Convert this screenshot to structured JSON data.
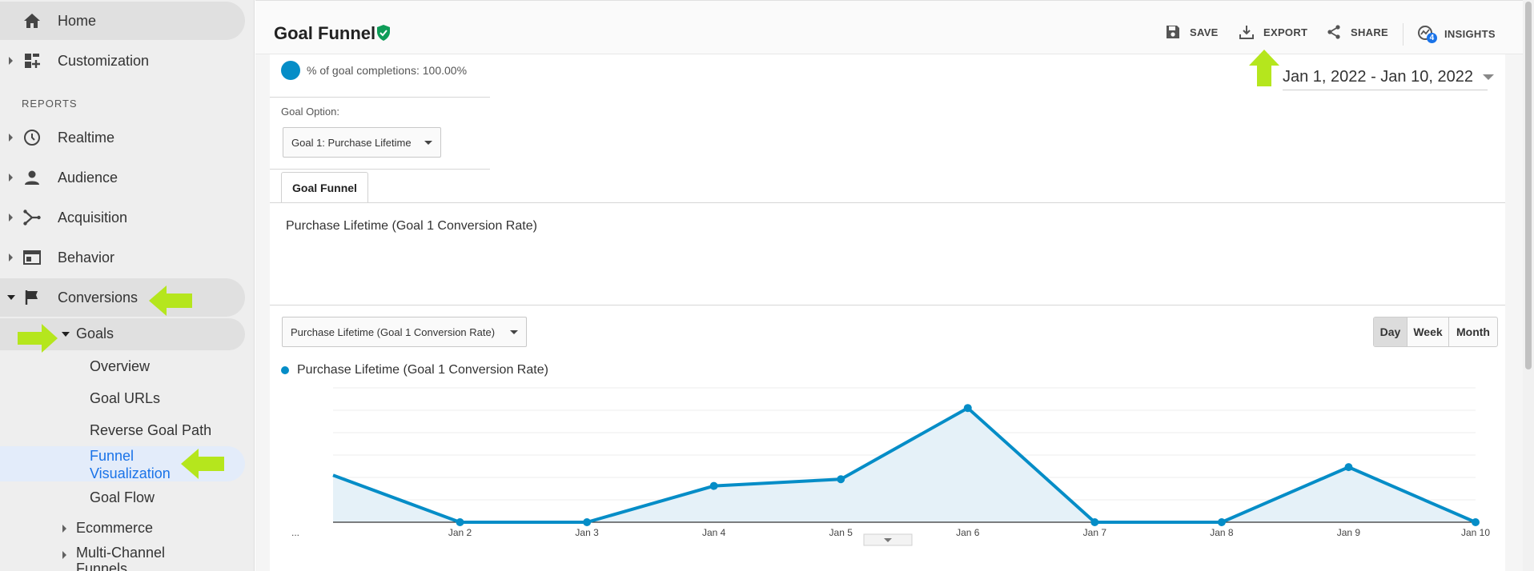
{
  "sidebar": {
    "home": "Home",
    "customization": "Customization",
    "reports_heading": "REPORTS",
    "realtime": "Realtime",
    "audience": "Audience",
    "acquisition": "Acquisition",
    "behavior": "Behavior",
    "conversions": "Conversions",
    "goals": "Goals",
    "goal_items": [
      "Overview",
      "Goal URLs",
      "Reverse Goal Path",
      "Funnel",
      "Visualization",
      "Goal Flow"
    ],
    "ecommerce": "Ecommerce",
    "multichannel_1": "Multi-Channel",
    "multichannel_2": "Funnels"
  },
  "header": {
    "title": "Goal Funnel",
    "save": "SAVE",
    "export": "EXPORT",
    "share": "SHARE",
    "insights": "INSIGHTS",
    "insights_badge": "4"
  },
  "report": {
    "completion_text": "% of goal completions: 100.00%",
    "goal_option_label": "Goal Option:",
    "goal_option_value": "Goal 1: Purchase Lifetime",
    "tab_label": "Goal Funnel",
    "metric_title": "Purchase Lifetime (Goal 1 Conversion Rate)",
    "date_range": "Jan 1, 2022 - Jan 10, 2022",
    "metric_select": "Purchase Lifetime (Goal 1 Conversion Rate)",
    "granularity": [
      "Day",
      "Week",
      "Month"
    ],
    "granularity_selected": "Day"
  },
  "colors": {
    "accent": "#058dc7",
    "highlight_arrow": "#b5e61d",
    "verified": "#0f9d58",
    "active_link": "#1a73e8"
  },
  "chart_data": {
    "type": "area",
    "series": [
      {
        "name": "Purchase Lifetime (Goal 1 Conversion Rate)",
        "x": [
          "...",
          "Jan 2",
          "Jan 3",
          "Jan 4",
          "Jan 5",
          "Jan 6",
          "Jan 7",
          "Jan 8",
          "Jan 9",
          "Jan 10"
        ],
        "values": [
          0.35,
          0,
          0,
          0.27,
          0.32,
          0.85,
          0,
          0,
          0.41,
          0
        ]
      }
    ],
    "x_tick_labels": [
      "...",
      "Jan 2",
      "Jan 3",
      "Jan 4",
      "Jan 5",
      "Jan 6",
      "Jan 7",
      "Jan 8",
      "Jan 9",
      "Jan 10"
    ],
    "ylim": [
      0,
      1
    ],
    "grid": true
  }
}
